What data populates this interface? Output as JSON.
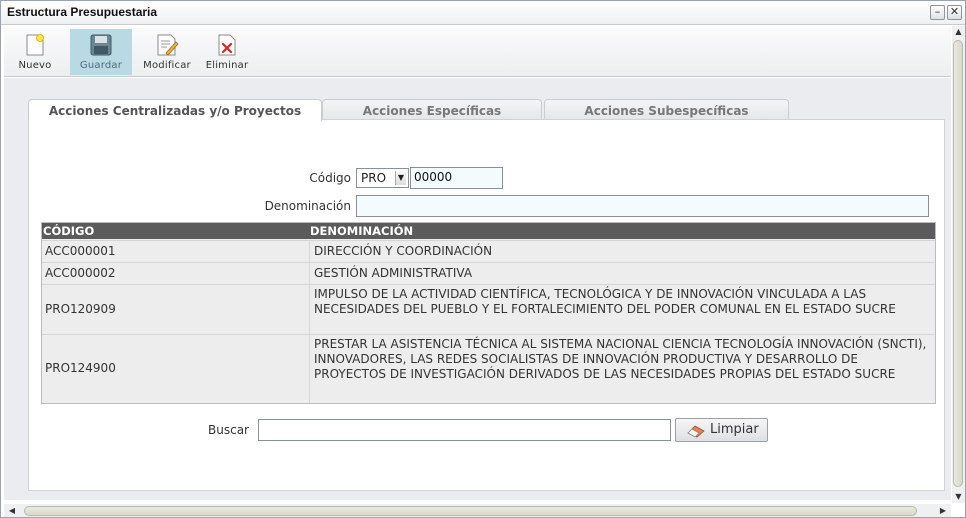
{
  "window": {
    "title": "Estructura Presupuestaria",
    "minimize": "–",
    "close": "✕"
  },
  "toolbar": {
    "nuevo": "Nuevo",
    "guardar": "Guardar",
    "modificar": "Modificar",
    "eliminar": "Eliminar"
  },
  "tabs": [
    {
      "label": "Acciones Centralizadas y/o Proyectos",
      "active": true
    },
    {
      "label": "Acciones Específicas",
      "active": false
    },
    {
      "label": "Acciones Subespecíficas",
      "active": false
    }
  ],
  "form": {
    "codigo_label": "Código",
    "codigo_prefix": "PRO",
    "codigo_value": "00000",
    "denominacion_label": "Denominación",
    "denominacion_value": ""
  },
  "grid": {
    "headers": [
      "CÓDIGO",
      "DENOMINACIÓN"
    ],
    "rows": [
      {
        "codigo": "ACC000001",
        "denominacion": "DIRECCIÓN Y COORDINACIÓN"
      },
      {
        "codigo": "ACC000002",
        "denominacion": "GESTIÓN ADMINISTRATIVA"
      },
      {
        "codigo": "PRO120909",
        "denominacion": "IMPULSO DE LA ACTIVIDAD CIENTÍFICA, TECNOLÓGICA Y DE INNOVACIÓN VINCULADA A LAS NECESIDADES DEL PUEBLO Y EL FORTALECIMIENTO DEL PODER COMUNAL EN EL ESTADO SUCRE"
      },
      {
        "codigo": "PRO124900",
        "denominacion": "PRESTAR LA ASISTENCIA TÉCNICA AL SISTEMA NACIONAL CIENCIA TECNOLOGÍA INNOVACIÓN (SNCTI), INNOVADORES, LAS REDES SOCIALISTAS DE INNOVACIÓN PRODUCTIVA Y DESARROLLO DE PROYECTOS DE INVESTIGACIÓN DERIVADOS DE LAS NECESIDADES PROPIAS DEL ESTADO SUCRE"
      }
    ]
  },
  "search": {
    "label": "Buscar",
    "value": "",
    "clear_button": "Limpiar"
  },
  "icons": {
    "nuevo": "new-document-icon",
    "guardar": "floppy-disk-icon",
    "modificar": "edit-document-icon",
    "eliminar": "delete-document-icon",
    "limpiar": "eraser-icon"
  },
  "colors": {
    "active_button": "#b9d9e3",
    "grid_header": "#5b5b5b",
    "input_bg": "#f3fbfd"
  }
}
